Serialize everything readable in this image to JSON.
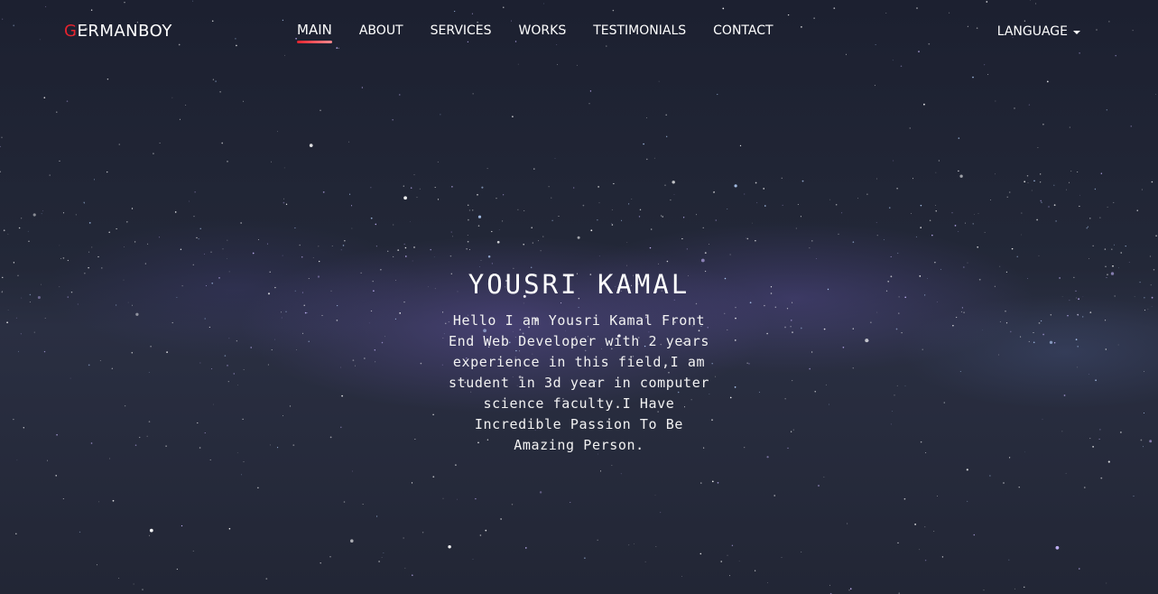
{
  "brand": {
    "first_letter": "G",
    "rest": "ERMANBOY"
  },
  "nav": {
    "items": [
      {
        "label": "MAIN",
        "active": true
      },
      {
        "label": "ABOUT",
        "active": false
      },
      {
        "label": "SERVICES",
        "active": false
      },
      {
        "label": "WORKS",
        "active": false
      },
      {
        "label": "TESTIMONIALS",
        "active": false
      },
      {
        "label": "CONTACT",
        "active": false
      }
    ],
    "language_label": "LANGUAGE"
  },
  "hero": {
    "title": "YOUSRI KAMAL",
    "text": "Hello I am Yousri Kamal Front End Web Developer with 2 years experience in this field,I am student in 3d year in computer science faculty.I Have Incredible Passion To Be Amazing Person."
  },
  "colors": {
    "accent": "#e3232e",
    "text": "#ffffff",
    "background": "#232838"
  },
  "icons": {
    "language_dropdown": "caret-down-icon",
    "background": "starfield-background"
  }
}
